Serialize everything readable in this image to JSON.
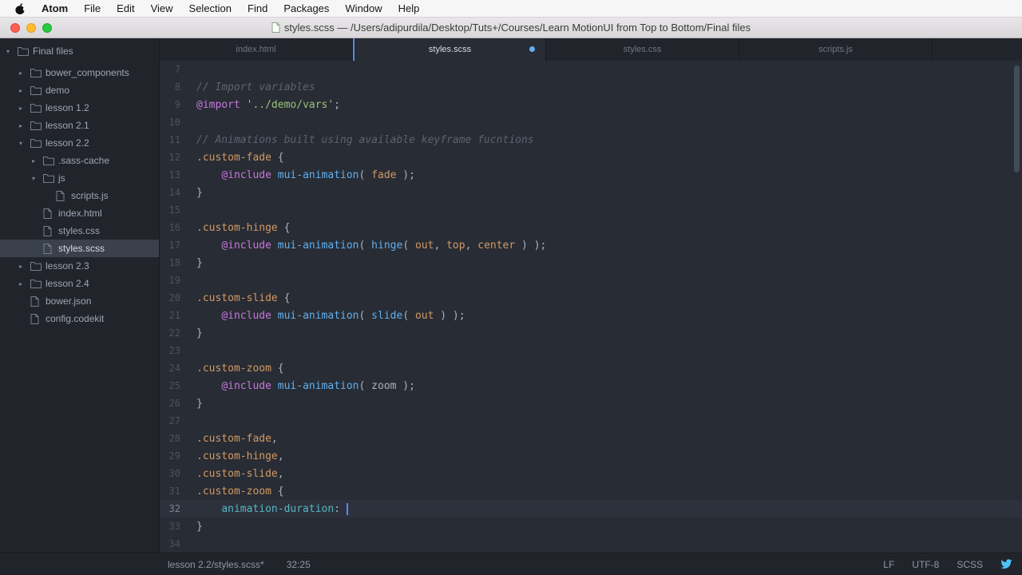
{
  "menu_bar": {
    "items": [
      "Atom",
      "File",
      "Edit",
      "View",
      "Selection",
      "Find",
      "Packages",
      "Window",
      "Help"
    ]
  },
  "title_bar": {
    "title": "styles.scss — /Users/adipurdila/Desktop/Tuts+/Courses/Learn MotionUI from Top to Bottom/Final files"
  },
  "sidebar": {
    "tree": [
      {
        "label": "Final files",
        "depth": 0,
        "type": "folder",
        "expanded": true,
        "selected": false
      },
      {
        "label": "bower_components",
        "depth": 1,
        "type": "folder",
        "expanded": false,
        "selected": false
      },
      {
        "label": "demo",
        "depth": 1,
        "type": "folder",
        "expanded": false,
        "selected": false
      },
      {
        "label": "lesson 1.2",
        "depth": 1,
        "type": "folder",
        "expanded": false,
        "selected": false
      },
      {
        "label": "lesson 2.1",
        "depth": 1,
        "type": "folder",
        "expanded": false,
        "selected": false
      },
      {
        "label": "lesson 2.2",
        "depth": 1,
        "type": "folder",
        "expanded": true,
        "selected": false
      },
      {
        "label": ".sass-cache",
        "depth": 2,
        "type": "folder",
        "expanded": false,
        "selected": false
      },
      {
        "label": "js",
        "depth": 2,
        "type": "folder",
        "expanded": true,
        "selected": false
      },
      {
        "label": "scripts.js",
        "depth": 3,
        "type": "file",
        "expanded": null,
        "selected": false
      },
      {
        "label": "index.html",
        "depth": 2,
        "type": "file",
        "expanded": null,
        "selected": false
      },
      {
        "label": "styles.css",
        "depth": 2,
        "type": "file",
        "expanded": null,
        "selected": false
      },
      {
        "label": "styles.scss",
        "depth": 2,
        "type": "file",
        "expanded": null,
        "selected": true
      },
      {
        "label": "lesson 2.3",
        "depth": 1,
        "type": "folder",
        "expanded": false,
        "selected": false
      },
      {
        "label": "lesson 2.4",
        "depth": 1,
        "type": "folder",
        "expanded": false,
        "selected": false
      },
      {
        "label": "bower.json",
        "depth": 1,
        "type": "file",
        "expanded": null,
        "selected": false
      },
      {
        "label": "config.codekit",
        "depth": 1,
        "type": "file",
        "expanded": null,
        "selected": false
      }
    ]
  },
  "tabs": [
    {
      "label": "index.html",
      "active": false,
      "modified": false
    },
    {
      "label": "styles.scss",
      "active": true,
      "modified": true
    },
    {
      "label": "styles.css",
      "active": false,
      "modified": false
    },
    {
      "label": "scripts.js",
      "active": false,
      "modified": false
    }
  ],
  "editor": {
    "lines": [
      {
        "n": 7,
        "t": []
      },
      {
        "n": 8,
        "t": [
          [
            "c",
            "// Import variables"
          ]
        ]
      },
      {
        "n": 9,
        "t": [
          [
            "k",
            "@import"
          ],
          [
            "d",
            " "
          ],
          [
            "s",
            "'../demo/vars'"
          ],
          [
            "d",
            ";"
          ]
        ]
      },
      {
        "n": 10,
        "t": []
      },
      {
        "n": 11,
        "t": [
          [
            "c",
            "// Animations built using available keyframe fucntions"
          ]
        ]
      },
      {
        "n": 12,
        "t": [
          [
            "o",
            ".custom-fade"
          ],
          [
            "d",
            " {"
          ]
        ]
      },
      {
        "n": 13,
        "t": [
          [
            "d",
            "    "
          ],
          [
            "k",
            "@include"
          ],
          [
            "d",
            " "
          ],
          [
            "f",
            "mui-animation"
          ],
          [
            "d",
            "( "
          ],
          [
            "o",
            "fade"
          ],
          [
            "d",
            " );"
          ]
        ]
      },
      {
        "n": 14,
        "t": [
          [
            "d",
            "}"
          ]
        ]
      },
      {
        "n": 15,
        "t": []
      },
      {
        "n": 16,
        "t": [
          [
            "o",
            ".custom-hinge"
          ],
          [
            "d",
            " {"
          ]
        ]
      },
      {
        "n": 17,
        "t": [
          [
            "d",
            "    "
          ],
          [
            "k",
            "@include"
          ],
          [
            "d",
            " "
          ],
          [
            "f",
            "mui-animation"
          ],
          [
            "d",
            "( "
          ],
          [
            "f",
            "hinge"
          ],
          [
            "d",
            "( "
          ],
          [
            "o",
            "out"
          ],
          [
            "d",
            ", "
          ],
          [
            "o",
            "top"
          ],
          [
            "d",
            ", "
          ],
          [
            "o",
            "center"
          ],
          [
            "d",
            " ) );"
          ]
        ]
      },
      {
        "n": 18,
        "t": [
          [
            "d",
            "}"
          ]
        ]
      },
      {
        "n": 19,
        "t": []
      },
      {
        "n": 20,
        "t": [
          [
            "o",
            ".custom-slide"
          ],
          [
            "d",
            " {"
          ]
        ]
      },
      {
        "n": 21,
        "t": [
          [
            "d",
            "    "
          ],
          [
            "k",
            "@include"
          ],
          [
            "d",
            " "
          ],
          [
            "f",
            "mui-animation"
          ],
          [
            "d",
            "( "
          ],
          [
            "f",
            "slide"
          ],
          [
            "d",
            "( "
          ],
          [
            "o",
            "out"
          ],
          [
            "d",
            " ) );"
          ]
        ]
      },
      {
        "n": 22,
        "t": [
          [
            "d",
            "}"
          ]
        ]
      },
      {
        "n": 23,
        "t": []
      },
      {
        "n": 24,
        "t": [
          [
            "o",
            ".custom-zoom"
          ],
          [
            "d",
            " {"
          ]
        ]
      },
      {
        "n": 25,
        "t": [
          [
            "d",
            "    "
          ],
          [
            "k",
            "@include"
          ],
          [
            "d",
            " "
          ],
          [
            "f",
            "mui-animation"
          ],
          [
            "d",
            "( "
          ],
          [
            "d",
            "zoom"
          ],
          [
            "d",
            " );"
          ]
        ]
      },
      {
        "n": 26,
        "t": [
          [
            "d",
            "}"
          ]
        ]
      },
      {
        "n": 27,
        "t": []
      },
      {
        "n": 28,
        "t": [
          [
            "o",
            ".custom-fade"
          ],
          [
            "d",
            ","
          ]
        ]
      },
      {
        "n": 29,
        "t": [
          [
            "o",
            ".custom-hinge"
          ],
          [
            "d",
            ","
          ]
        ]
      },
      {
        "n": 30,
        "t": [
          [
            "o",
            ".custom-slide"
          ],
          [
            "d",
            ","
          ]
        ]
      },
      {
        "n": 31,
        "t": [
          [
            "o",
            ".custom-zoom"
          ],
          [
            "d",
            " {"
          ]
        ]
      },
      {
        "n": 32,
        "t": [
          [
            "d",
            "    "
          ],
          [
            "p",
            "animation-duration"
          ],
          [
            "d",
            ": "
          ]
        ],
        "cursor": true,
        "current": true
      },
      {
        "n": 33,
        "t": [
          [
            "d",
            "}"
          ]
        ]
      },
      {
        "n": 34,
        "t": []
      }
    ]
  },
  "status_bar": {
    "path": "lesson 2.2/styles.scss*",
    "position": "32:25",
    "line_ending": "LF",
    "encoding": "UTF-8",
    "grammar": "SCSS"
  },
  "colors": {
    "accent_blue": "#528bff",
    "modified_dot": "#61afef",
    "tab_accent": "#568af2",
    "traffic_red": "#ff5f57",
    "traffic_yellow": "#febc2e",
    "traffic_green": "#28c840",
    "bird_blue": "#4fc3f7"
  }
}
